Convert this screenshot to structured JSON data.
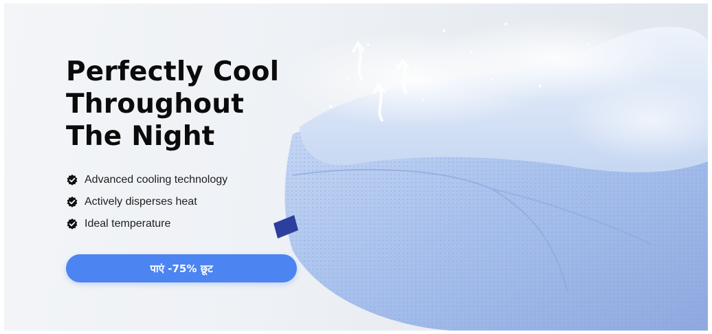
{
  "hero": {
    "headline_lines": [
      "Perfectly Cool",
      "Throughout",
      "The Night"
    ],
    "features": [
      "Advanced cooling technology",
      "Actively disperses heat",
      "Ideal temperature"
    ],
    "cta_label": "पाएं -75% छूट",
    "product_image": "cooling-pillow-image"
  },
  "colors": {
    "cta": "#4c84f2",
    "headline": "#0b0b0b",
    "check_icon": "#111111",
    "pillow": "#a9c3ee"
  }
}
